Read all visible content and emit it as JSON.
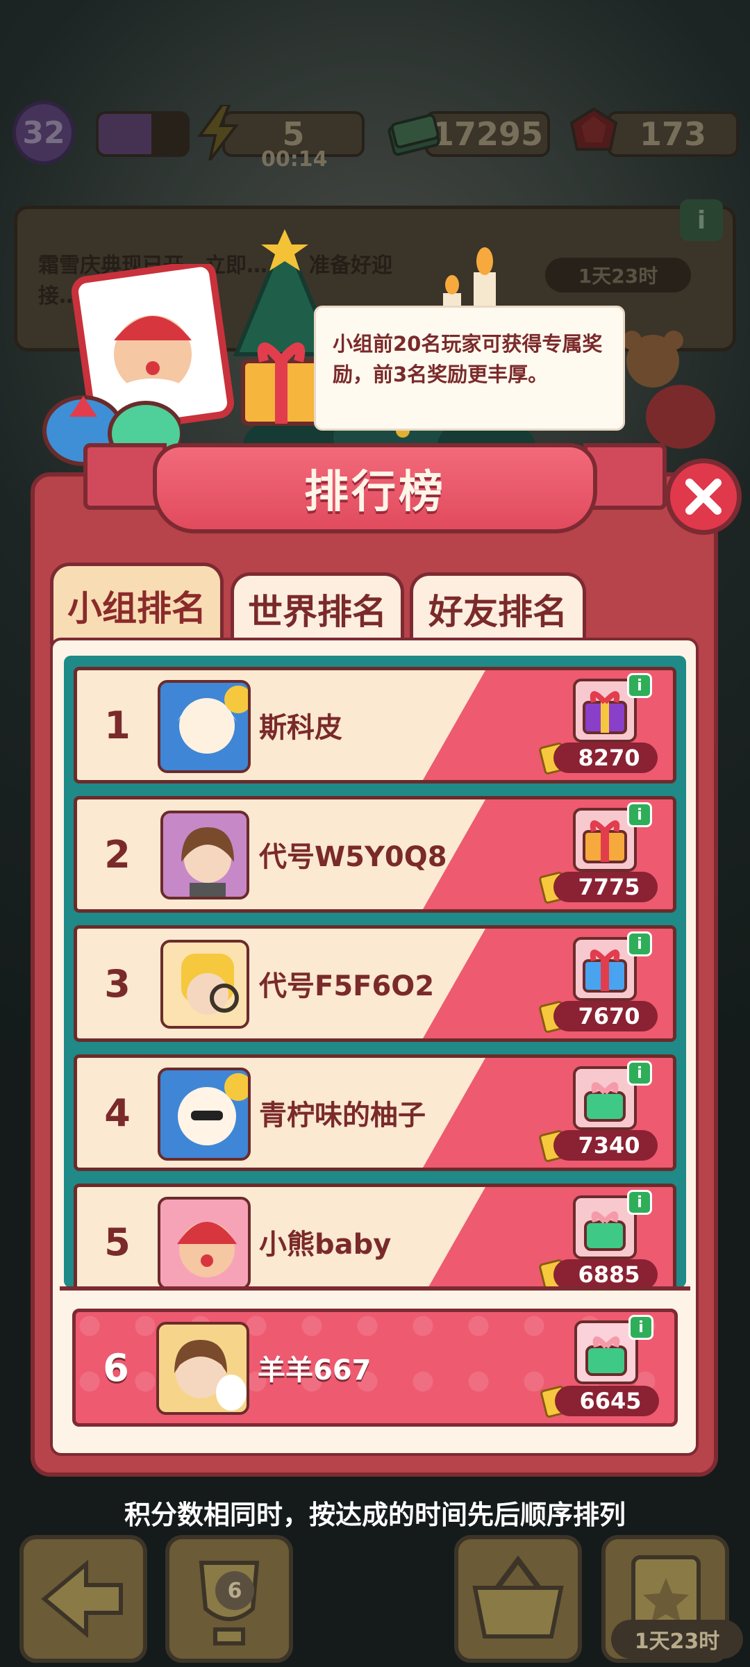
{
  "top_bar": {
    "level": "32",
    "level_progress": 0.6,
    "energy": "5",
    "energy_timer": "00:14",
    "cash": "17295",
    "gems": "173"
  },
  "event_banner": {
    "text": "霜雪庆典现已开…立即…入，准备好迎接…系列…",
    "timer": "1天23时",
    "info": "i"
  },
  "tooltip": {
    "text": "小组前20名玩家可获得专属奖励，前3名奖励更丰厚。"
  },
  "leaderboard": {
    "title": "排行榜",
    "tabs": [
      {
        "label": "小组排名",
        "active": true
      },
      {
        "label": "世界排名",
        "active": false
      },
      {
        "label": "好友排名",
        "active": false
      }
    ],
    "rows": [
      {
        "rank": "1",
        "name": "斯科皮",
        "score": "8270",
        "gift": "purple-gift-icon"
      },
      {
        "rank": "2",
        "name": "代号W5Y0Q8",
        "score": "7775",
        "gift": "orange-gift-icon"
      },
      {
        "rank": "3",
        "name": "代号F5F6O2",
        "score": "7670",
        "gift": "blue-gift-icon"
      },
      {
        "rank": "4",
        "name": "青柠味的柚子",
        "score": "7340",
        "gift": "green-gift-icon"
      },
      {
        "rank": "5",
        "name": "小熊baby",
        "score": "6885",
        "gift": "green-gift-icon"
      }
    ],
    "my_row": {
      "rank": "6",
      "name": "羊羊667",
      "score": "6645",
      "gift": "green-gift-icon"
    },
    "footer_note": "积分数相同时，按达成的时间先后顺序排列"
  },
  "bottom_nav": {
    "trophy_count": "6",
    "timer": "1天23时"
  },
  "colors": {
    "panel": "#b6444a",
    "row_bg": "#fbe9d2",
    "accent_pink": "#ee5a70",
    "teal": "#1f8a87"
  }
}
